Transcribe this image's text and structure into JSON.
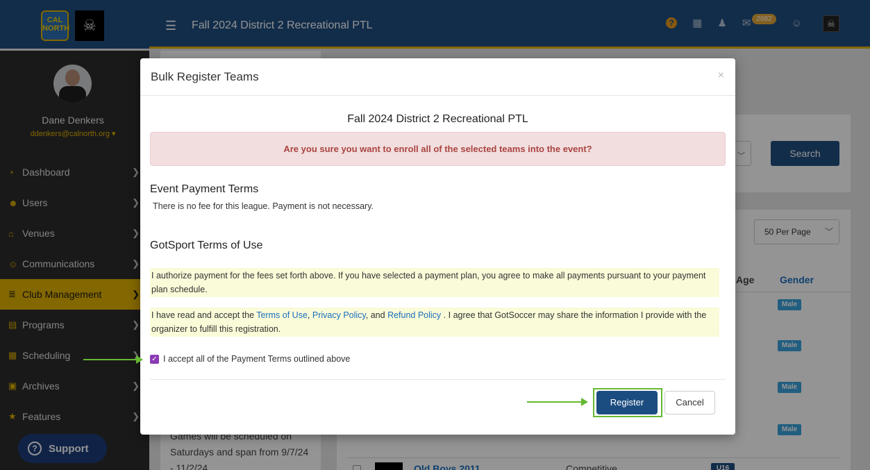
{
  "topbar": {
    "logo1_text": "CAL NORTH",
    "logo2_symbol": "☠",
    "menu_icon": "hamburger-icon",
    "title": "Fall 2024 District 2 Recreational PTL",
    "help_icon": "?",
    "qr_icon": "▦",
    "user_icon": "♟",
    "mail_icon": "✉",
    "mail_count": "2682",
    "chat_icon": "☺",
    "avatar_symbol": "☠"
  },
  "sidebar": {
    "user_name": "Dane Denkers",
    "user_email": "ddenkers@calnorth.org ▾",
    "items": [
      {
        "label": "Dashboard",
        "icon": "◔"
      },
      {
        "label": "Users",
        "icon": "☻"
      },
      {
        "label": "Venues",
        "icon": "⌂"
      },
      {
        "label": "Communications",
        "icon": "☺"
      },
      {
        "label": "Club Management",
        "icon": "≣"
      },
      {
        "label": "Programs",
        "icon": "▤"
      },
      {
        "label": "Scheduling",
        "icon": "▦"
      },
      {
        "label": "Archives",
        "icon": "▣"
      },
      {
        "label": "Features",
        "icon": "★"
      }
    ],
    "support_label": "Support"
  },
  "background": {
    "search_label": "Search",
    "per_page": "50 Per Page",
    "col_age": "Age",
    "col_gender": "Gender",
    "gender_tag": "Male",
    "desc_line1": "Games will be scheduled on",
    "desc_line2": "Saturdays and span from 9/7/24",
    "desc_line3": "- 11/2/24",
    "team_name": "Old Boys 2011",
    "team_level": "Competitive",
    "team_age": "U16"
  },
  "modal": {
    "title": "Bulk Register Teams",
    "close": "×",
    "event_name": "Fall 2024 District 2 Recreational PTL",
    "alert": "Are you sure you want to enroll all of the selected teams into the event?",
    "payment_heading": "Event Payment Terms",
    "payment_text": "There is no fee for this league. Payment is not necessary.",
    "terms_heading": "GotSport Terms of Use",
    "authorize_text": "I authorize payment for the fees set forth above. If you have selected a payment plan, you agree to make all payments pursuant to your payment plan schedule.",
    "accept_prefix": "I have read and accept the",
    "terms_link": "Terms of Use",
    "sep1": ",",
    "privacy_link": "Privacy Policy",
    "sep2": ", and",
    "refund_link": "Refund Policy",
    "accept_suffix": ". I agree that GotSoccer may share the information I provide with the organizer to fulfill this registration.",
    "checkbox_label": "I accept all of the Payment Terms outlined above",
    "checkbox_checked": true,
    "register_label": "Register",
    "cancel_label": "Cancel"
  },
  "colors": {
    "brand_blue": "#1f4e80",
    "accent_gold": "#e2b100",
    "annotation_green": "#65b832",
    "alert_red": "#a94442"
  }
}
